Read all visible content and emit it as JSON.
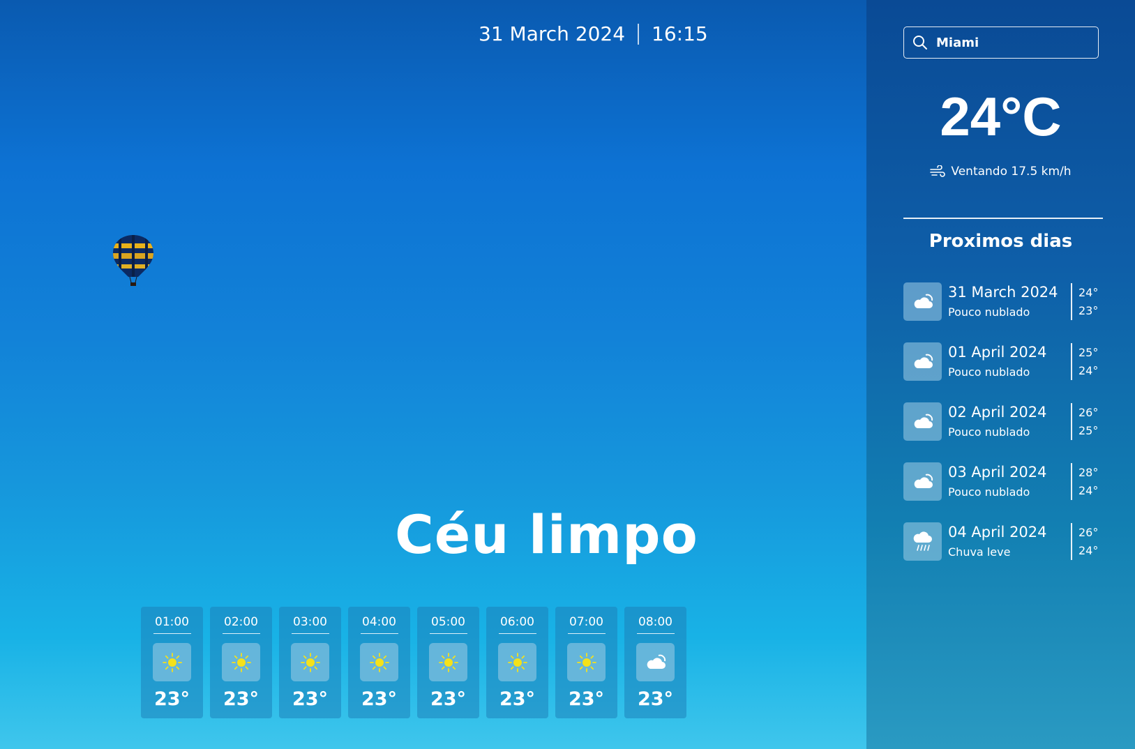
{
  "header": {
    "date": "31 March 2024",
    "time": "16:15"
  },
  "condition": "Céu limpo",
  "hourly": [
    {
      "time": "01:00",
      "icon": "sun-icon",
      "temp": "23°"
    },
    {
      "time": "02:00",
      "icon": "sun-icon",
      "temp": "23°"
    },
    {
      "time": "03:00",
      "icon": "sun-icon",
      "temp": "23°"
    },
    {
      "time": "04:00",
      "icon": "sun-icon",
      "temp": "23°"
    },
    {
      "time": "05:00",
      "icon": "sun-icon",
      "temp": "23°"
    },
    {
      "time": "06:00",
      "icon": "sun-icon",
      "temp": "23°"
    },
    {
      "time": "07:00",
      "icon": "sun-icon",
      "temp": "23°"
    },
    {
      "time": "08:00",
      "icon": "partly-cloudy-icon",
      "temp": "23°"
    }
  ],
  "search": {
    "value": "Miami"
  },
  "current": {
    "temp": "24°C",
    "wind": "Ventando 17.5 km/h"
  },
  "next_days": {
    "title": "Proximos dias",
    "items": [
      {
        "date": "31 March 2024",
        "desc": "Pouco nublado",
        "max": "24°",
        "min": "23°",
        "icon": "partly-cloudy-icon"
      },
      {
        "date": "01 April 2024",
        "desc": "Pouco nublado",
        "max": "25°",
        "min": "24°",
        "icon": "partly-cloudy-icon"
      },
      {
        "date": "02 April 2024",
        "desc": "Pouco nublado",
        "max": "26°",
        "min": "25°",
        "icon": "partly-cloudy-icon"
      },
      {
        "date": "03 April 2024",
        "desc": "Pouco nublado",
        "max": "28°",
        "min": "24°",
        "icon": "partly-cloudy-icon"
      },
      {
        "date": "04 April 2024",
        "desc": "Chuva leve",
        "max": "26°",
        "min": "24°",
        "icon": "rain-icon"
      }
    ]
  },
  "colors": {
    "sun": "#f5e11a",
    "card": "#1e82b9",
    "sidebar_top": "#0a4a95"
  }
}
